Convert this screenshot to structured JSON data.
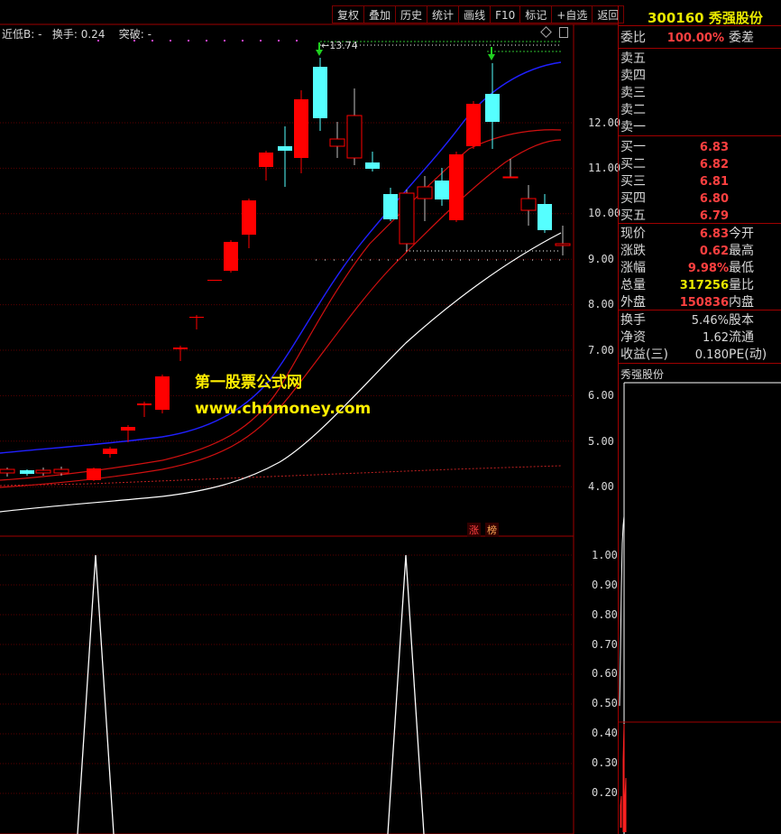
{
  "toolbar": {
    "items": [
      "复权",
      "叠加",
      "历史",
      "统计",
      "画线",
      "F10",
      "标记",
      "+自选",
      "返回"
    ]
  },
  "indicator_bar": {
    "near_low": "近低B: -",
    "turnover": "换手: 0.24",
    "breakout": "突破: -"
  },
  "chart": {
    "high_label": "13.74",
    "price_axis": [
      "12.00",
      "11.00",
      "10.00",
      "9.00",
      "8.00",
      "7.00",
      "6.00",
      "5.00",
      "4.00"
    ],
    "osc_axis": [
      "1.00",
      "0.90",
      "0.80",
      "0.70",
      "0.60",
      "0.50",
      "0.40",
      "0.30",
      "0.20"
    ],
    "tag1": "涨",
    "tag2": "榜",
    "watermark1": "第一股票公式网",
    "watermark2": "www.chnmoney.com"
  },
  "quote": {
    "code": "300160",
    "name": "秀强股份",
    "weibi_label": "委比",
    "weibi_value": "100.00%",
    "weicha_label": "委差",
    "sell": [
      {
        "label": "卖五"
      },
      {
        "label": "卖四"
      },
      {
        "label": "卖三"
      },
      {
        "label": "卖二"
      },
      {
        "label": "卖一"
      }
    ],
    "buy": [
      {
        "label": "买一",
        "price": "6.83"
      },
      {
        "label": "买二",
        "price": "6.82"
      },
      {
        "label": "买三",
        "price": "6.81"
      },
      {
        "label": "买四",
        "price": "6.80"
      },
      {
        "label": "买五",
        "price": "6.79"
      }
    ],
    "stats": [
      {
        "l1": "现价",
        "v": "6.83",
        "l2": "今开",
        "color": "#ff4040"
      },
      {
        "l1": "涨跌",
        "v": "0.62",
        "l2": "最高",
        "color": "#ff4040"
      },
      {
        "l1": "涨幅",
        "v": "9.98%",
        "l2": "最低",
        "color": "#ff4040"
      },
      {
        "l1": "总量",
        "v": "317256",
        "l2": "量比",
        "color": "#e8e800"
      },
      {
        "l1": "外盘",
        "v": "150836",
        "l2": "内盘",
        "color": "#ff4040"
      }
    ],
    "stats2": [
      {
        "l1": "换手",
        "v": "5.46%",
        "l2": "股本",
        "color": "#d8d8d8"
      },
      {
        "l1": "净资",
        "v": "1.62",
        "l2": "流通",
        "color": "#d8d8d8"
      },
      {
        "l1": "收益(三)",
        "v": "0.180",
        "l2": "PE(动)",
        "color": "#d8d8d8"
      }
    ],
    "mini_title": "秀强股份"
  },
  "colors": {
    "up": "#ff0000",
    "down": "#55ffff",
    "grid": "#7a0000",
    "border": "#a00000",
    "ma_blue": "#2020ff",
    "ma_red": "#d01010",
    "ma_white": "#ffffff",
    "watermark": "#ffee00"
  }
}
